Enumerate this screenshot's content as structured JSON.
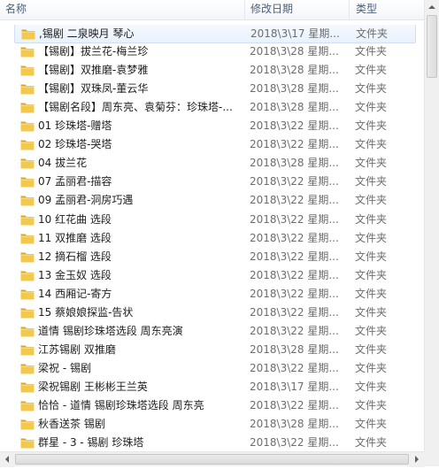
{
  "columns": {
    "name": "名称",
    "modified": "修改日期",
    "type": "类型"
  },
  "colors": {
    "folder": "#f2c94c",
    "folder_dark": "#d9a528",
    "selection": "#e8f1fc",
    "header_text": "#4c607a"
  },
  "icons": {
    "row": "folder-icon",
    "scroll_up": "arrow-up-icon",
    "scroll_left": "arrow-left-icon",
    "scroll_right": "arrow-right-icon"
  },
  "rows": [
    {
      "name": ",锡剧 二泉映月 琴心",
      "date": "2018\\3\\17 星期...",
      "type": "文件夹",
      "selected": true
    },
    {
      "name": "【锡剧】拔兰花-梅兰珍",
      "date": "2018\\3\\28 星期...",
      "type": "文件夹"
    },
    {
      "name": "【锡剧】双推磨-袁梦雅",
      "date": "2018\\3\\28 星期...",
      "type": "文件夹"
    },
    {
      "name": "【锡剧】双珠凤-董云华",
      "date": "2018\\3\\28 星期...",
      "type": "文件夹"
    },
    {
      "name": "【锡剧名段】周东亮、袁菊芬：珍珠塔-...",
      "date": "2018\\3\\28 星期...",
      "type": "文件夹"
    },
    {
      "name": "01 珍珠塔-赠塔",
      "date": "2018\\3\\22 星期...",
      "type": "文件夹"
    },
    {
      "name": "02 珍珠塔-哭塔",
      "date": "2018\\3\\22 星期...",
      "type": "文件夹"
    },
    {
      "name": "04 拔兰花",
      "date": "2018\\3\\28 星期...",
      "type": "文件夹"
    },
    {
      "name": "07 孟丽君-描容",
      "date": "2018\\3\\22 星期...",
      "type": "文件夹"
    },
    {
      "name": "09 孟丽君-洞房巧遇",
      "date": "2018\\3\\22 星期...",
      "type": "文件夹"
    },
    {
      "name": "10 红花曲  选段",
      "date": "2018\\3\\22 星期...",
      "type": "文件夹"
    },
    {
      "name": "11 双推磨  选段",
      "date": "2018\\3\\22 星期...",
      "type": "文件夹"
    },
    {
      "name": "12 摘石榴  选段",
      "date": "2018\\3\\22 星期...",
      "type": "文件夹"
    },
    {
      "name": "13 金玉奴  选段",
      "date": "2018\\3\\22 星期...",
      "type": "文件夹"
    },
    {
      "name": "14 西厢记-寄方",
      "date": "2018\\3\\22 星期...",
      "type": "文件夹"
    },
    {
      "name": "15 蔡娘娘探监-告状",
      "date": "2018\\3\\22 星期...",
      "type": "文件夹"
    },
    {
      "name": "道情 锡剧珍珠塔选段 周东亮演",
      "date": "2018\\3\\22 星期...",
      "type": "文件夹"
    },
    {
      "name": "江苏锡剧 双推磨",
      "date": "2018\\3\\28 星期...",
      "type": "文件夹"
    },
    {
      "name": "梁祝 - 锡剧",
      "date": "2018\\3\\22 星期...",
      "type": "文件夹"
    },
    {
      "name": "梁祝锡剧 王彬彬王兰英",
      "date": "2018\\3\\17 星期...",
      "type": "文件夹"
    },
    {
      "name": "恰恰 - 道情  锡剧珍珠塔选段 周东亮",
      "date": "2018\\3\\22 星期...",
      "type": "文件夹"
    },
    {
      "name": "秋香送茶 锡剧",
      "date": "2018\\3\\28 星期...",
      "type": "文件夹"
    },
    {
      "name": "群星 - 3 - 锡剧 珍珠塔",
      "date": "2018\\3\\22 星期...",
      "type": "文件夹"
    }
  ]
}
